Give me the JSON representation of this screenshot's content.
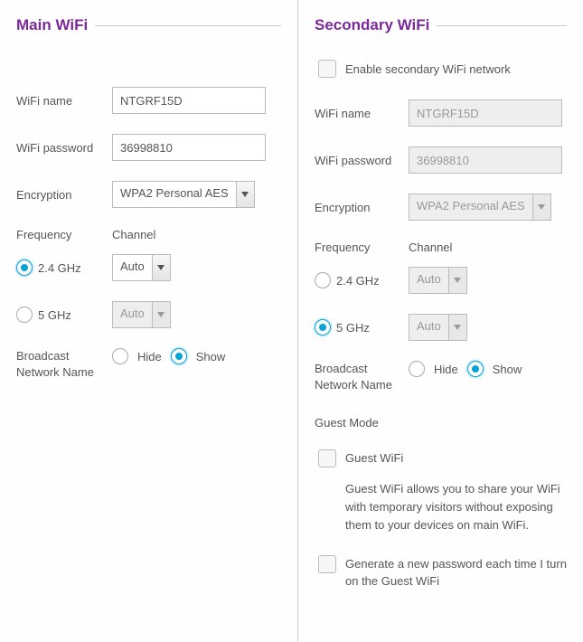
{
  "main": {
    "title": "Main WiFi",
    "name_label": "WiFi name",
    "name_value": "NTGRF15D",
    "password_label": "WiFi password",
    "password_value": "36998810",
    "encryption_label": "Encryption",
    "encryption_value": "WPA2 Personal AES",
    "frequency_label": "Frequency",
    "channel_label": "Channel",
    "freq_24_label": "2.4 GHz",
    "freq_24_selected": true,
    "freq_24_channel": "Auto",
    "freq_5_label": "5 GHz",
    "freq_5_selected": false,
    "freq_5_channel": "Auto",
    "broadcast_label": "Broadcast Network Name",
    "hide_label": "Hide",
    "show_label": "Show",
    "broadcast_show_selected": true
  },
  "secondary": {
    "title": "Secondary WiFi",
    "enable_label": "Enable secondary WiFi network",
    "enable_checked": false,
    "name_label": "WiFi name",
    "name_value": "NTGRF15D",
    "password_label": "WiFi password",
    "password_value": "36998810",
    "encryption_label": "Encryption",
    "encryption_value": "WPA2 Personal AES",
    "frequency_label": "Frequency",
    "channel_label": "Channel",
    "freq_24_label": "2.4 GHz",
    "freq_24_selected": false,
    "freq_24_channel": "Auto",
    "freq_5_label": "5 GHz",
    "freq_5_selected": true,
    "freq_5_channel": "Auto",
    "broadcast_label": "Broadcast Network Name",
    "hide_label": "Hide",
    "show_label": "Show",
    "broadcast_show_selected": true,
    "guest_mode_label": "Guest Mode",
    "guest_wifi_label": "Guest WiFi",
    "guest_wifi_checked": false,
    "guest_desc": "Guest WiFi allows you to share your WiFi with temporary visitors without exposing them to your devices on main WiFi.",
    "generate_label": "Generate a new password each time I turn on the Guest WiFi",
    "generate_checked": false
  }
}
